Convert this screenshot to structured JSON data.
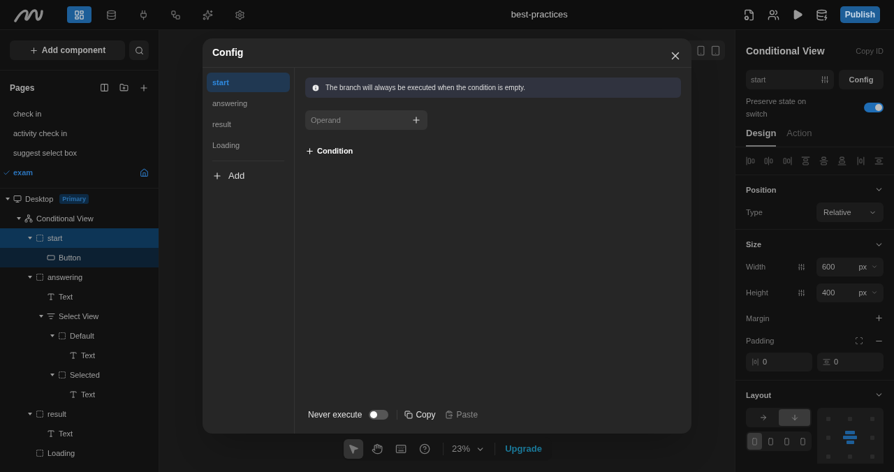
{
  "top_bar": {
    "nav": [
      {
        "kind": "pages",
        "selected": true
      },
      {
        "kind": "data",
        "selected": false
      },
      {
        "kind": "api",
        "selected": false
      },
      {
        "kind": "flow",
        "selected": false
      },
      {
        "kind": "ai",
        "selected": false
      },
      {
        "kind": "settings",
        "selected": false
      }
    ],
    "title": "best-practices",
    "publish": "Publish"
  },
  "sidebar": {
    "add_component": "Add component",
    "pages_title": "Pages",
    "pages": [
      {
        "label": "check in",
        "selected": false,
        "home": false
      },
      {
        "label": "activity check in",
        "selected": false,
        "home": false
      },
      {
        "label": "suggest select box",
        "selected": false,
        "home": false
      },
      {
        "label": "exam",
        "selected": true,
        "home": true
      }
    ],
    "layers": [
      {
        "label": "Desktop",
        "kind": "desktop",
        "badge": "Primary",
        "selected": false,
        "highlighted": false,
        "expanded": true,
        "children": [
          {
            "label": "Conditional View",
            "kind": "conditional",
            "selected": false,
            "highlighted": false,
            "expanded": true,
            "children": [
              {
                "label": "start",
                "kind": "container",
                "selected": true,
                "expanded": true,
                "children": [
                  {
                    "label": "Button",
                    "kind": "button",
                    "selected": false,
                    "highlighted": true
                  }
                ]
              },
              {
                "label": "answering",
                "kind": "container",
                "selected": false,
                "highlighted": false,
                "expanded": true,
                "children": [
                  {
                    "label": "Text",
                    "kind": "text",
                    "selected": false,
                    "highlighted": false
                  },
                  {
                    "label": "Select View",
                    "kind": "select",
                    "selected": false,
                    "highlighted": false,
                    "expanded": true,
                    "children": [
                      {
                        "label": "Default",
                        "kind": "container",
                        "selected": false,
                        "highlighted": false,
                        "expanded": true,
                        "children": [
                          {
                            "label": "Text",
                            "kind": "text",
                            "selected": false,
                            "highlighted": false
                          }
                        ]
                      },
                      {
                        "label": "Selected",
                        "kind": "container",
                        "selected": false,
                        "highlighted": false,
                        "expanded": true,
                        "children": [
                          {
                            "label": "Text",
                            "kind": "text",
                            "selected": false,
                            "highlighted": false
                          }
                        ]
                      }
                    ]
                  }
                ]
              },
              {
                "label": "result",
                "kind": "container",
                "selected": false,
                "highlighted": false,
                "expanded": true,
                "children": [
                  {
                    "label": "Text",
                    "kind": "text",
                    "selected": false,
                    "highlighted": false
                  }
                ]
              },
              {
                "label": "Loading",
                "kind": "container",
                "selected": false,
                "highlighted": false
              }
            ]
          }
        ]
      }
    ]
  },
  "dialog": {
    "title": "Config",
    "branches": [
      {
        "label": "start",
        "selected": true
      },
      {
        "label": "answering",
        "selected": false
      },
      {
        "label": "result",
        "selected": false
      },
      {
        "label": "Loading",
        "selected": false
      }
    ],
    "add": "Add",
    "notice": "The branch will always be executed when the condition is empty.",
    "operand_placeholder": "Operand",
    "condition": "Condition",
    "never_execute": {
      "label": "Never execute",
      "on": false
    },
    "copy": {
      "label": "Copy",
      "disabled": false
    },
    "paste": {
      "label": "Paste",
      "disabled": true
    }
  },
  "canvas_toolbar": {
    "tools": [
      {
        "kind": "pointer",
        "selected": true
      },
      {
        "kind": "hand",
        "selected": false
      },
      {
        "kind": "keyboard",
        "selected": false
      },
      {
        "kind": "help",
        "selected": false
      }
    ],
    "zoom": "23%",
    "upgrade": "Upgrade"
  },
  "inspector": {
    "title": "Conditional View",
    "copy_id": "Copy ID",
    "state_value": "start",
    "config": "Config",
    "preserve": {
      "label": "Preserve state on switch",
      "on": true
    },
    "tabs": [
      {
        "label": "Design",
        "selected": true
      },
      {
        "label": "Action",
        "selected": false
      }
    ],
    "position": {
      "title": "Position",
      "type_label": "Type",
      "type_value": "Relative"
    },
    "size": {
      "title": "Size",
      "fields": [
        {
          "label": "Width",
          "value": "600",
          "unit": "px"
        },
        {
          "label": "Height",
          "value": "400",
          "unit": "px"
        }
      ],
      "margin": "Margin",
      "padding": "Padding",
      "padding_fields": [
        {
          "kind": "horizontal",
          "value": "0"
        },
        {
          "kind": "vertical",
          "value": "0"
        }
      ]
    },
    "layout": {
      "title": "Layout",
      "directions": [
        {
          "kind": "row",
          "selected": false
        },
        {
          "kind": "column",
          "selected": true
        }
      ],
      "aligns": [
        {
          "selected": true
        },
        {
          "selected": false
        },
        {
          "selected": false
        },
        {
          "selected": false
        }
      ],
      "cells": [
        {
          "selected": false
        },
        {
          "selected": false
        },
        {
          "selected": false
        },
        {
          "selected": false
        },
        {
          "selected": true
        },
        {
          "selected": false
        },
        {
          "selected": false
        },
        {
          "selected": false
        },
        {
          "selected": false
        }
      ]
    }
  }
}
